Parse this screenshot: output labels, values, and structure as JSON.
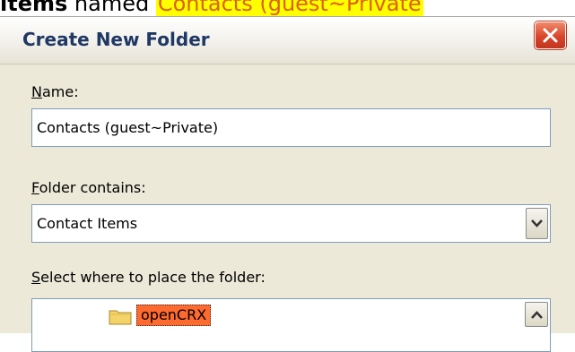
{
  "caption": {
    "bold_prefix": "items",
    "middle": " named ",
    "highlight": "Contacts (guest~Private"
  },
  "dialog": {
    "title": "Create New Folder",
    "name_label_underlined": "N",
    "name_label_rest": "ame:",
    "name_value": "Contacts (guest~Private)",
    "contains_label_underlined": "F",
    "contains_label_rest": "older contains:",
    "contains_value": "Contact Items",
    "place_label_underlined": "S",
    "place_label_rest": "elect where to place the folder:",
    "tree_items": [
      {
        "label": "openCRX",
        "selected": true
      }
    ]
  },
  "colors": {
    "highlight_bg": "#ffff00",
    "selection": "#ff6a2e",
    "dialog_bg": "#ECE9D8"
  }
}
